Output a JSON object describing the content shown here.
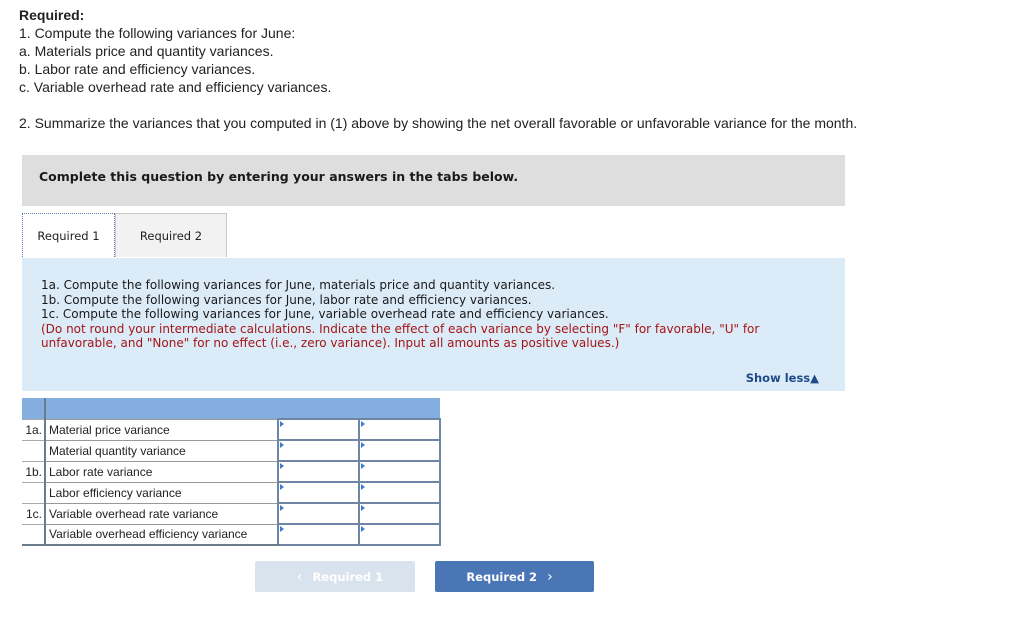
{
  "required": {
    "title": "Required:",
    "lines": [
      "1. Compute the following variances for June:",
      "a. Materials price and quantity variances.",
      "b. Labor rate and efficiency variances.",
      "c. Variable overhead rate and efficiency variances."
    ],
    "line2": "2. Summarize the variances that you computed in (1) above by showing the net overall favorable or unfavorable variance for the month."
  },
  "banner": "Complete this question by entering your answers in the tabs below.",
  "tabs": [
    {
      "label": "Required 1",
      "active": true
    },
    {
      "label": "Required 2",
      "active": false
    }
  ],
  "instructions": {
    "lines": [
      "1a. Compute the following variances for June, materials price and quantity variances.",
      "1b. Compute the following variances for June, labor rate and efficiency variances.",
      "1c. Compute the following variances for June, variable overhead rate and efficiency variances."
    ],
    "note": "(Do not round your intermediate calculations. Indicate the effect of each variance by selecting \"F\" for favorable, \"U\" for unfavorable, and \"None\" for no effect (i.e., zero variance). Input all amounts as positive values.)",
    "show_less": "Show less",
    "show_less_icon": "▲"
  },
  "table": {
    "rows": [
      {
        "code": "1a.",
        "label": "Material price variance",
        "amount": "",
        "effect": ""
      },
      {
        "code": "",
        "label": "Material quantity variance",
        "amount": "",
        "effect": ""
      },
      {
        "code": "1b.",
        "label": "Labor rate variance",
        "amount": "",
        "effect": ""
      },
      {
        "code": "",
        "label": "Labor efficiency variance",
        "amount": "",
        "effect": ""
      },
      {
        "code": "1c.",
        "label": "Variable overhead rate variance",
        "amount": "",
        "effect": ""
      },
      {
        "code": "",
        "label": "Variable overhead efficiency variance",
        "amount": "",
        "effect": ""
      }
    ]
  },
  "nav": {
    "prev_label": "Required 1",
    "prev_icon": "‹",
    "next_label": "Required 2",
    "next_icon": "›"
  },
  "colors": {
    "accent": "#4a76b5",
    "note_red": "#a31515",
    "instructions_bg": "#dcebf8",
    "table_header": "#84aee0"
  }
}
